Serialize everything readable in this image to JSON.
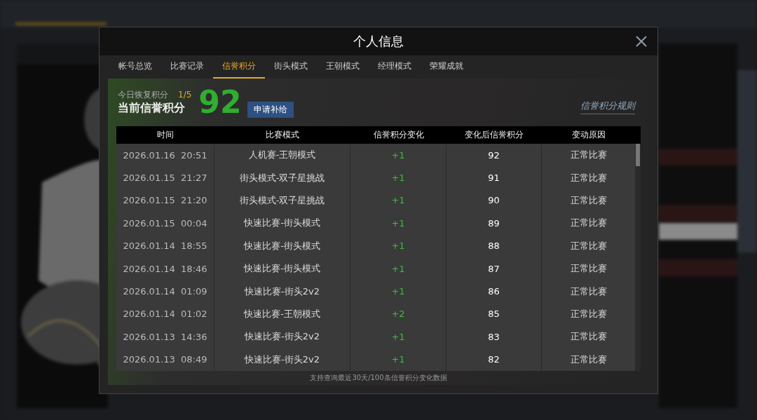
{
  "dialog": {
    "title": "个人信息"
  },
  "tabs": [
    {
      "label": "帐号总览",
      "selected": false
    },
    {
      "label": "比赛记录",
      "selected": false
    },
    {
      "label": "信誉积分",
      "selected": true
    },
    {
      "label": "街头模式",
      "selected": false
    },
    {
      "label": "王朝模式",
      "selected": false
    },
    {
      "label": "经理模式",
      "selected": false
    },
    {
      "label": "荣耀成就",
      "selected": false
    }
  ],
  "summary": {
    "recover_label": "今日恢复积分",
    "recover_count": "1/5",
    "current_label": "当前信誉积分",
    "score": "92",
    "apply_button": "申请补给",
    "rules_link": "信誉积分规则"
  },
  "table": {
    "columns": [
      "时间",
      "比赛模式",
      "信誉积分变化",
      "变化后信誉积分",
      "变动原因"
    ],
    "rows": [
      [
        "2026.01.16  20:51",
        "人机赛-王朝模式",
        "+1",
        "92",
        "正常比赛"
      ],
      [
        "2026.01.15  21:27",
        "街头模式-双子星挑战",
        "+1",
        "91",
        "正常比赛"
      ],
      [
        "2026.01.15  21:20",
        "街头模式-双子星挑战",
        "+1",
        "90",
        "正常比赛"
      ],
      [
        "2026.01.15  00:04",
        "快速比赛-街头模式",
        "+1",
        "89",
        "正常比赛"
      ],
      [
        "2026.01.14  18:55",
        "快速比赛-街头模式",
        "+1",
        "88",
        "正常比赛"
      ],
      [
        "2026.01.14  18:46",
        "快速比赛-街头模式",
        "+1",
        "87",
        "正常比赛"
      ],
      [
        "2026.01.14  01:09",
        "快速比赛-街头2v2",
        "+1",
        "86",
        "正常比赛"
      ],
      [
        "2026.01.14  01:02",
        "快速比赛-王朝模式",
        "+2",
        "85",
        "正常比赛"
      ],
      [
        "2026.01.13  14:36",
        "快速比赛-街头2v2",
        "+1",
        "83",
        "正常比赛"
      ],
      [
        "2026.01.13  08:49",
        "快速比赛-街头2v2",
        "+1",
        "82",
        "正常比赛"
      ]
    ]
  },
  "footer_note": "支持查询最近30天/100条信誉积分变化数据"
}
